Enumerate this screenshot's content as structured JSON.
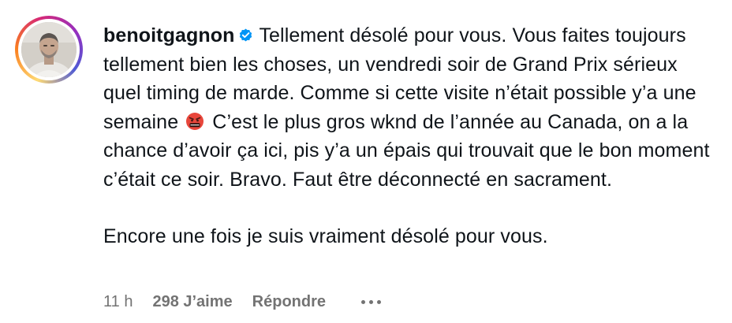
{
  "comment": {
    "username": "benoitgagnon",
    "verified_icon": "verified-badge-icon",
    "text_part1": "Tellement désolé pour vous. Vous faites toujours tellement bien les choses, un vendredi soir de Grand Prix sérieux quel timing de marde. Comme si cette visite n’était possible y’a une semaine",
    "emoji": "angry-face-with-symbols-icon",
    "emoji_glyph": "🤬",
    "text_part2": "C’est le plus gros wknd de l’année au Canada, on a la chance d’avoir ça ici, pis y’a un épais qui trouvait que le bon moment c’était ce soir. Bravo. Faut être déconnecté en sacrament.",
    "text_paragraph2": "Encore une fois je suis vraiment désolé pour vous.",
    "time": "11 h",
    "likes": "298 J’aime",
    "reply_label": "Répondre"
  },
  "colors": {
    "text": "#0f1419",
    "meta": "#737373",
    "verified": "#0095f6"
  }
}
